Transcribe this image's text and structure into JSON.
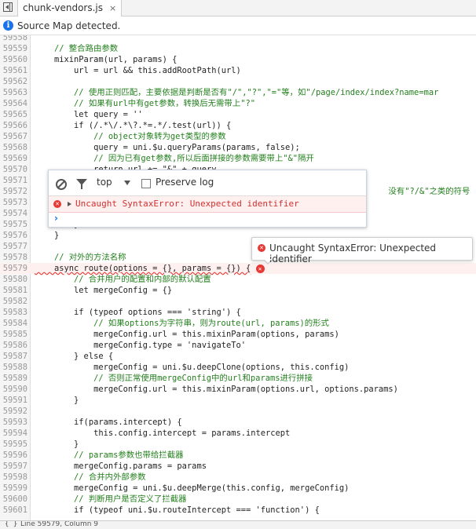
{
  "tab": {
    "file_name": "chunk-vendors.js",
    "close": "×"
  },
  "infobar": {
    "icon": "info-icon",
    "text": "Source Map detected."
  },
  "code_lines": [
    {
      "n": "59558",
      "t": ""
    },
    {
      "n": "59559",
      "t": "    // 整合路由参数",
      "cls": "c"
    },
    {
      "n": "59560",
      "t": "    mixinParam(url, params) {"
    },
    {
      "n": "59561",
      "t": "        url = url && this.addRootPath(url)"
    },
    {
      "n": "59562",
      "t": ""
    },
    {
      "n": "59563",
      "t": "        // 使用正则匹配，主要依据是判断是否有\"/\",\"?\",\"=\"等，如\"/page/index/index?name=mar",
      "cls": "c"
    },
    {
      "n": "59564",
      "t": "        // 如果有url中有get参数，转换后无需带上\"?\"",
      "cls": "c"
    },
    {
      "n": "59565",
      "t": "        let query = ''"
    },
    {
      "n": "59566",
      "t": "        if (/.*\\/.*\\?.*=.*/.test(url)) {"
    },
    {
      "n": "59567",
      "t": "            // object对象转为get类型的参数",
      "cls": "c"
    },
    {
      "n": "59568",
      "t": "            query = uni.$u.queryParams(params, false);"
    },
    {
      "n": "59569",
      "t": "            // 因为已有get参数,所以后面拼接的参数需要带上\"&\"隔开",
      "cls": "c"
    },
    {
      "n": "59570",
      "t": "            return url += \"&\" + query"
    },
    {
      "n": "59571",
      "t": ""
    },
    {
      "n": "59572",
      "t": "                                                                        没有\"?/&\"之类的符号",
      "cls": "c"
    },
    {
      "n": "59573",
      "t": ""
    },
    {
      "n": "59574",
      "t": ""
    },
    {
      "n": "59575",
      "t": "        }"
    },
    {
      "n": "59576",
      "t": "    }"
    },
    {
      "n": "59577",
      "t": ""
    },
    {
      "n": "59578",
      "t": "    // 对外的方法名称",
      "cls": "c"
    },
    {
      "n": "59579",
      "t": "    async route(options = {}, params = {}) {",
      "err": true
    },
    {
      "n": "59580",
      "t": "        // 合并用户的配置和内部的默认配置",
      "cls": "c"
    },
    {
      "n": "59581",
      "t": "        let mergeConfig = {}"
    },
    {
      "n": "59582",
      "t": ""
    },
    {
      "n": "59583",
      "t": "        if (typeof options === 'string') {"
    },
    {
      "n": "59584",
      "t": "            // 如果options为字符串，则为route(url, params)的形式",
      "cls": "c"
    },
    {
      "n": "59585",
      "t": "            mergeConfig.url = this.mixinParam(options, params)"
    },
    {
      "n": "59586",
      "t": "            mergeConfig.type = 'navigateTo'"
    },
    {
      "n": "59587",
      "t": "        } else {"
    },
    {
      "n": "59588",
      "t": "            mergeConfig = uni.$u.deepClone(options, this.config)"
    },
    {
      "n": "59589",
      "t": "            // 否则正常使用mergeConfig中的url和params进行拼接",
      "cls": "c"
    },
    {
      "n": "59590",
      "t": "            mergeConfig.url = this.mixinParam(options.url, options.params)"
    },
    {
      "n": "59591",
      "t": "        }"
    },
    {
      "n": "59592",
      "t": ""
    },
    {
      "n": "59593",
      "t": "        if(params.intercept) {"
    },
    {
      "n": "59594",
      "t": "            this.config.intercept = params.intercept"
    },
    {
      "n": "59595",
      "t": "        }"
    },
    {
      "n": "59596",
      "t": "        // params参数也带给拦截器",
      "cls": "c"
    },
    {
      "n": "59597",
      "t": "        mergeConfig.params = params"
    },
    {
      "n": "59598",
      "t": "        // 合并内外部参数",
      "cls": "c"
    },
    {
      "n": "59599",
      "t": "        mergeConfig = uni.$u.deepMerge(this.config, mergeConfig)"
    },
    {
      "n": "59600",
      "t": "        // 判断用户是否定义了拦截器",
      "cls": "c"
    },
    {
      "n": "59601",
      "t": "        if (typeof uni.$u.routeIntercept === 'function') {"
    }
  ],
  "console": {
    "context": "top",
    "preserve_log": "Preserve log",
    "error_text": "Uncaught SyntaxError: Unexpected identifier",
    "prompt": "›"
  },
  "tooltip": {
    "text": "Uncaught SyntaxError: Unexpected identifier"
  },
  "statusbar": {
    "icon": "{ }",
    "text": "Line 59579, Column 9"
  },
  "colors": {
    "error": "#e53935",
    "comment": "#237f1d",
    "accent": "#1a73e8"
  }
}
